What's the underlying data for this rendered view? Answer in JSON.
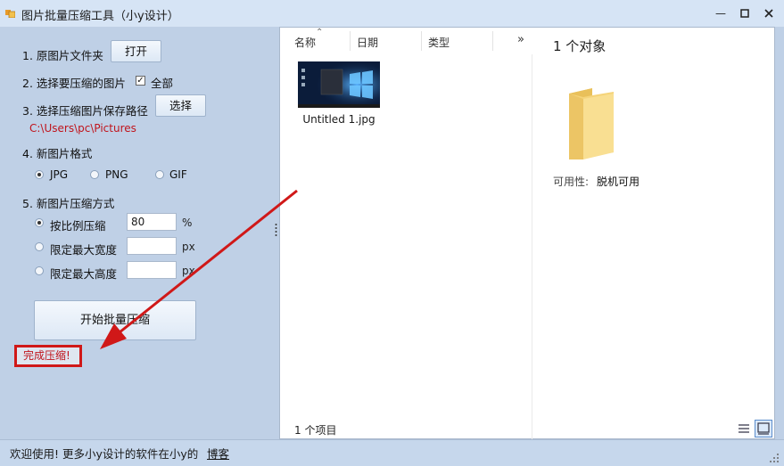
{
  "window": {
    "title": "图片批量压缩工具（小y设计）"
  },
  "steps": {
    "step1_label": "1. 原图片文件夹",
    "open_button": "打开",
    "step2_label": "2. 选择要压缩的图片",
    "select_all_label": "全部",
    "select_all_checked": true,
    "step3_label": "3. 选择压缩图片保存路径",
    "choose_button": "选择",
    "save_path": "C:\\Users\\pc\\Pictures",
    "step4_label": "4. 新图片格式",
    "formats": [
      "JPG",
      "PNG",
      "GIF"
    ],
    "selected_format": "JPG",
    "step5_label": "5. 新图片压缩方式",
    "mode_ratio_label": "按比例压缩",
    "ratio_value": "80",
    "ratio_unit": "%",
    "mode_width_label": "限定最大宽度",
    "width_value": "",
    "width_unit": "px",
    "mode_height_label": "限定最大高度",
    "height_value": "",
    "height_unit": "px",
    "selected_mode": "按比例压缩",
    "start_button": "开始批量压缩",
    "status_message": "完成压缩!"
  },
  "explorer": {
    "columns": [
      "名称",
      "日期",
      "类型"
    ],
    "more_columns_glyph": "»",
    "file_name": "Untitled 1.jpg",
    "item_count": "1 个项目",
    "details_title": "1 个对象",
    "availability_label": "可用性:",
    "availability_value": "脱机可用"
  },
  "statusbar": {
    "welcome_text": "欢迎使用! 更多小y设计的软件在小y的",
    "blog_link": "博客"
  },
  "colors": {
    "window_bg": "#bfd0e6",
    "path_red": "#c0141c",
    "annotation_red": "#d01818",
    "folder_yellow": "#f5d47a"
  }
}
